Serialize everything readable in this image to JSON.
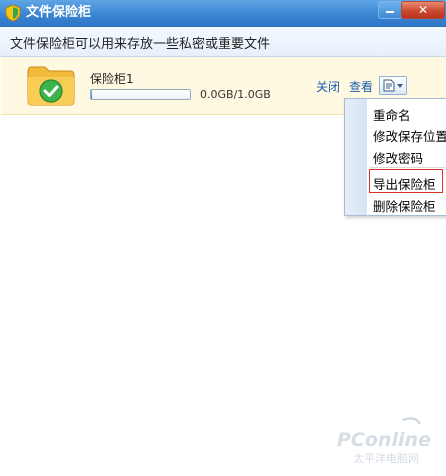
{
  "window": {
    "title": "文件保险柜",
    "close_label": "✕"
  },
  "header": {
    "description": "文件保险柜可以用来存放一些私密或重要文件"
  },
  "safe": {
    "name": "保险柜1",
    "usage": "0.0GB/1.0GB",
    "progress_fraction": 0.01,
    "actions": {
      "close": "关闭",
      "view": "查看"
    }
  },
  "menu": {
    "items": [
      {
        "label": "重命名"
      },
      {
        "label": "修改保存位置"
      },
      {
        "label": "修改密码"
      },
      {
        "label": "导出保险柜"
      },
      {
        "label": "删除保险柜"
      }
    ]
  },
  "watermark": {
    "brand": "PConline",
    "subtitle": "太平洋电脑网"
  },
  "colors": {
    "titlebar": "#3b84d2",
    "safe_row_bg": "#fff9e1",
    "link": "#1b5fb3",
    "highlight": "#e0302a"
  },
  "icons": {
    "app": "shield-icon",
    "safe": "folder-check-icon",
    "menu_button": "document-icon"
  }
}
